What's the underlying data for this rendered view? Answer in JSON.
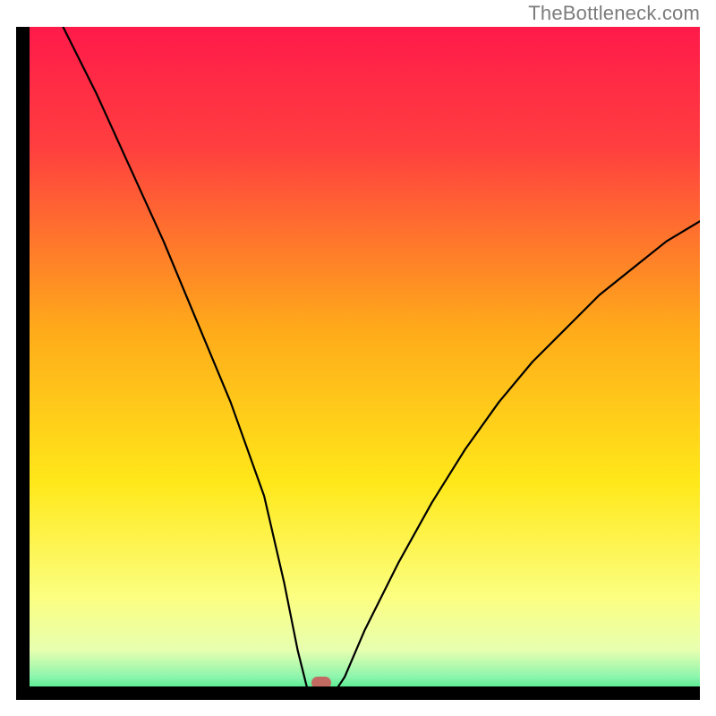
{
  "watermark": "TheBottleneck.com",
  "chart_data": {
    "type": "line",
    "title": "",
    "xlabel": "",
    "ylabel": "",
    "xlim": [
      0,
      100
    ],
    "ylim": [
      0,
      100
    ],
    "gradient_stops": [
      {
        "offset": 0,
        "color": "#ff1a4a"
      },
      {
        "offset": 0.18,
        "color": "#ff3f3f"
      },
      {
        "offset": 0.45,
        "color": "#ffaa1a"
      },
      {
        "offset": 0.68,
        "color": "#ffe81a"
      },
      {
        "offset": 0.85,
        "color": "#fcff80"
      },
      {
        "offset": 0.93,
        "color": "#e7ffb0"
      },
      {
        "offset": 0.97,
        "color": "#8cf5ad"
      },
      {
        "offset": 1.0,
        "color": "#27e177"
      }
    ],
    "series": [
      {
        "name": "bottleneck-curve",
        "x": [
          5,
          10,
          15,
          20,
          25,
          30,
          35,
          38,
          40,
          41.5,
          43,
          45,
          47,
          50,
          55,
          60,
          65,
          70,
          75,
          80,
          85,
          90,
          95,
          100
        ],
        "y": [
          100,
          90,
          79,
          68,
          56,
          44,
          30,
          17,
          7,
          1,
          0,
          0,
          3,
          10,
          20,
          29,
          37,
          44,
          50,
          55,
          60,
          64,
          68,
          71
        ]
      }
    ],
    "marker": {
      "x": 43.5,
      "y": 0.5,
      "color": "#c26a62"
    }
  }
}
